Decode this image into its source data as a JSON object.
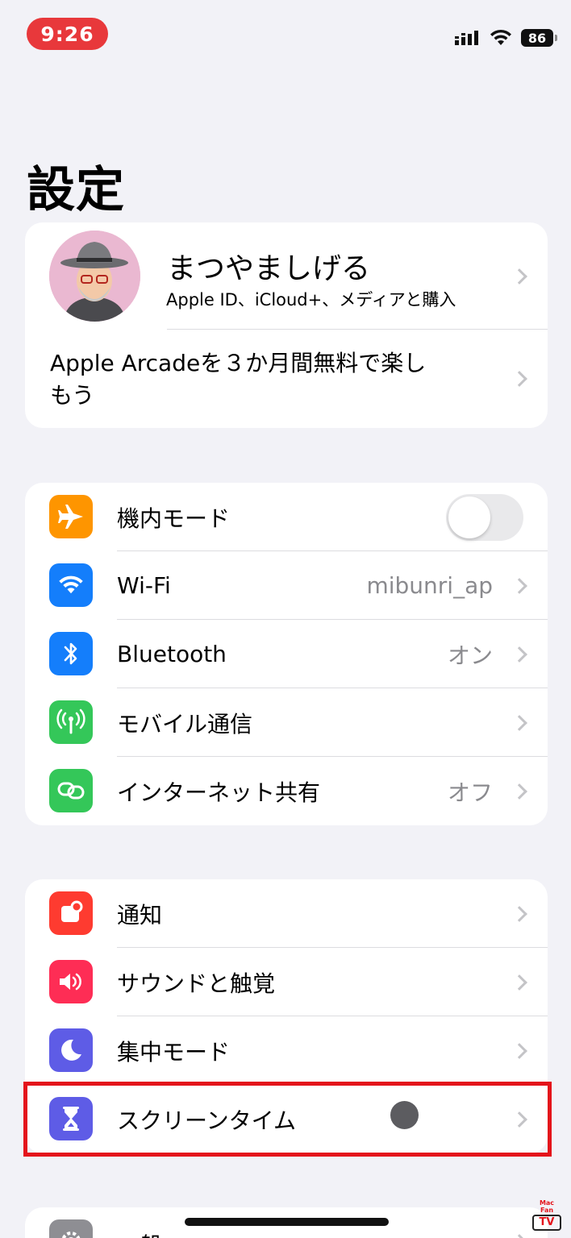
{
  "status_bar": {
    "time": "9:26",
    "battery": "86",
    "time_pill_color": "#e8383b"
  },
  "page_title": "設定",
  "profile": {
    "name": "まつやましげる",
    "subtitle": "Apple ID、iCloud+、メディアと購入",
    "avatar_icon": "memoji-avatar"
  },
  "arcade_offer": {
    "text": "Apple Arcadeを３か月間無料で楽しもう"
  },
  "connectivity": [
    {
      "label": "機内モード",
      "icon": "airplane-icon",
      "color": "#fe9500",
      "toggle": "off"
    },
    {
      "label": "Wi-Fi",
      "value": "mibunri_ap",
      "icon": "wifi-icon",
      "color": "#147efb"
    },
    {
      "label": "Bluetooth",
      "value": "オン",
      "icon": "bluetooth-icon",
      "color": "#147efb"
    },
    {
      "label": "モバイル通信",
      "icon": "antenna-icon",
      "color": "#34c759"
    },
    {
      "label": "インターネット共有",
      "value": "オフ",
      "icon": "hotspot-icon",
      "color": "#34c759"
    }
  ],
  "notifications_group": [
    {
      "label": "通知",
      "icon": "bell-icon",
      "color": "#fe3b30"
    },
    {
      "label": "サウンドと触覚",
      "icon": "speaker-icon",
      "color": "#fe2d55"
    },
    {
      "label": "集中モード",
      "icon": "moon-icon",
      "color": "#5e5ce6"
    },
    {
      "label": "スクリーンタイム",
      "icon": "hourglass-icon",
      "color": "#5e5ce6"
    }
  ],
  "general_group": [
    {
      "label": "一般",
      "icon": "gear-icon",
      "color": "#8e8e93"
    }
  ],
  "watermark": {
    "line1": "Mac Fan",
    "line2": "TV"
  },
  "highlight_color": "#e4141b"
}
